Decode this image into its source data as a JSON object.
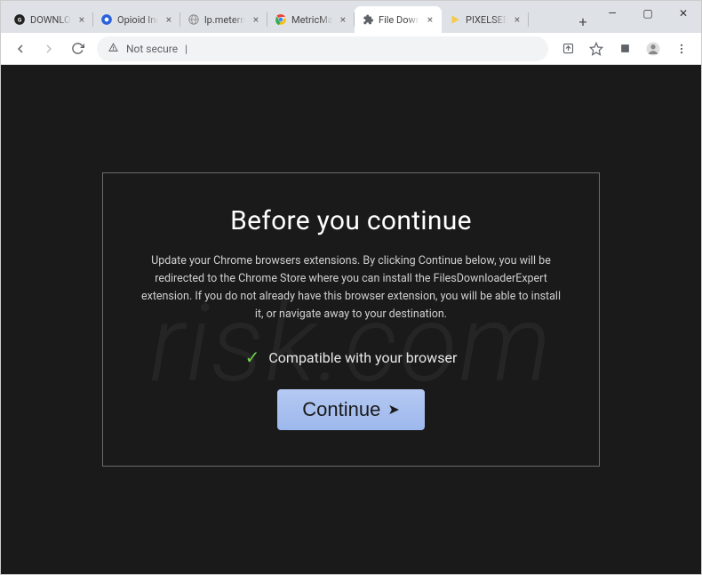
{
  "window": {
    "tabs": [
      {
        "title": "DOWNLOAD",
        "active": false,
        "icon": "globe"
      },
      {
        "title": "Opioid Induc",
        "active": false,
        "icon": "blue-circle"
      },
      {
        "title": "lp.metermast",
        "active": false,
        "icon": "globe-gray"
      },
      {
        "title": "MetricMaster",
        "active": false,
        "icon": "chrome"
      },
      {
        "title": "File Download",
        "active": true,
        "icon": "puzzle"
      },
      {
        "title": "PIXELSEE | Yo",
        "active": false,
        "icon": "play-yellow"
      }
    ],
    "new_tab_label": "+",
    "controls": {
      "min": "—",
      "max": "▢",
      "close": "✕"
    }
  },
  "addressbar": {
    "security_label": "Not secure",
    "url_suffix": "|",
    "icons": {
      "share": "share",
      "star": "star",
      "ext": "extensions",
      "profile": "profile",
      "menu": "menu"
    }
  },
  "modal": {
    "heading": "Before you continue",
    "body": "Update your Chrome browsers extensions. By clicking Continue below, you will be redirected to the Chrome Store where you can install the FilesDownloaderExpert extension. If you do not already have this browser extension, you will be able to install it, or navigate away to your destination.",
    "compat_text": "Compatible with your browser",
    "button_label": "Continue"
  },
  "watermark": "risk.com"
}
